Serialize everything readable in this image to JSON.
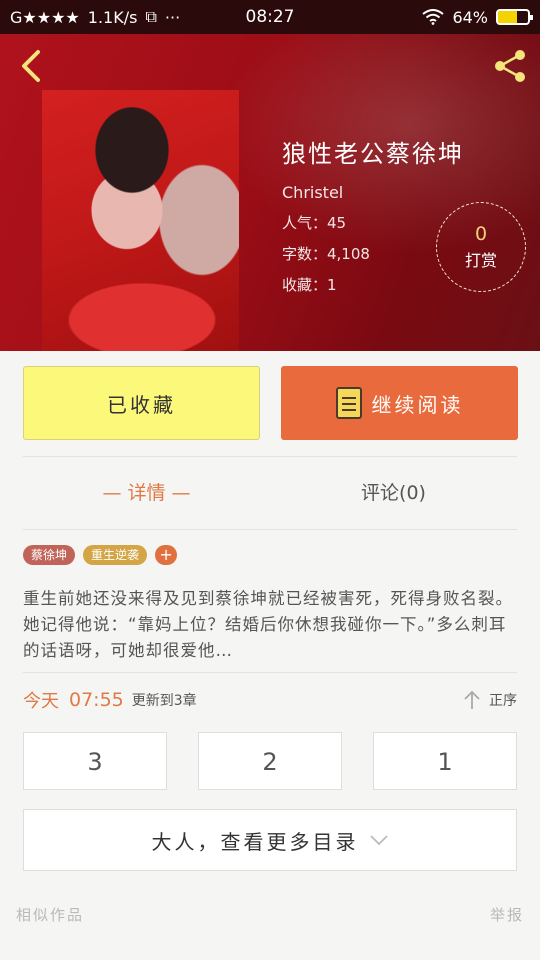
{
  "status_bar": {
    "carrier": "G★★★★",
    "speed": "1.1K/s",
    "time": "08:27",
    "battery": "64%",
    "battery_level": 0.64
  },
  "book": {
    "title": "狼性老公蔡徐坤",
    "author": "Christel",
    "popularity": "人气：45",
    "word_count": "字数：4,108",
    "favorites": "收藏：1"
  },
  "reward": {
    "count": "0",
    "label": "打赏"
  },
  "actions": {
    "collected": "已收藏",
    "continue": "继续阅读"
  },
  "tabs": {
    "detail": "— 详情 —",
    "comments": "评论(0)"
  },
  "tags": [
    "蔡徐坤",
    "重生逆袭"
  ],
  "tag_add": "+",
  "description": "重生前她还没来得及见到蔡徐坤就已经被害死，死得身败名裂。她记得他说：“靠妈上位？结婚后你休想我碰你一下。”多么刺耳的话语呀，可她却很爱他…",
  "update": {
    "day": "今天",
    "time": "07:55",
    "text": "更新到3章",
    "sort": "正序"
  },
  "chapters": [
    "3",
    "2",
    "1"
  ],
  "more_catalog": "大人，查看更多目录",
  "footer": {
    "similar": "相似作品",
    "report": "举报"
  },
  "colors": {
    "accent": "#e96a3c",
    "collected_bg": "#fbf87a",
    "header_red": "#a50f18"
  }
}
